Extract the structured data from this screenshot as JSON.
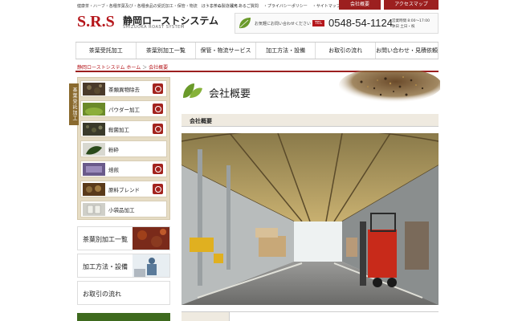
{
  "header": {
    "tagline": "健康茶・ハーブ・各種茶葉及び・各種食品の受託加工・保管・物流　ほうじ茶の製造販売",
    "logo": "S.R.S",
    "company_name": "静岡ローストシステム",
    "company_sub": "SHIZUOKA ROAST SYSTEM",
    "top_links": [
      "・ホーム",
      "・よくあるご質問",
      "・プライバシーポリシー",
      "・サイトマップ"
    ],
    "btn_company": "会社概要",
    "btn_access": "アクセスマップ",
    "contact_text": "お気軽にお問い合わせください",
    "tel_label": "TEL",
    "tel_number": "0548-54-1124",
    "hours_line1": "営業時間 8:00～17:00",
    "hours_line2": "休日 土日・祝"
  },
  "nav": {
    "items": [
      "茶葉受託加工",
      "茶葉別加工一覧",
      "保管・物流サービス",
      "加工方法・設備",
      "お取引の流れ",
      "お問い合わせ・見積依頼"
    ]
  },
  "breadcrumb": {
    "home": "静岡ローストシステム ホーム",
    "sep": "＞",
    "current": "会社概要"
  },
  "sidebar": {
    "vertical_label": "茶葉受託加工",
    "categories": [
      {
        "label": "茶類異物除去",
        "badge": true
      },
      {
        "label": "パウダー加工",
        "badge": true
      },
      {
        "label": "殺菌加工",
        "badge": true
      },
      {
        "label": "粉砕",
        "badge": false
      },
      {
        "label": "焙煎",
        "badge": true
      },
      {
        "label": "原料ブレンド",
        "badge": true
      },
      {
        "label": "小袋品加工",
        "badge": false
      }
    ],
    "boxes": [
      "茶葉別加工一覧",
      "加工方法・設備",
      "お取引の流れ"
    ]
  },
  "main": {
    "page_title": "会社概要",
    "section_title": "会社概要"
  },
  "colors": {
    "brand_red": "#9c1f1f",
    "sidebar_bg": "#e6dcc4",
    "sidebar_label": "#8a6a2e"
  }
}
